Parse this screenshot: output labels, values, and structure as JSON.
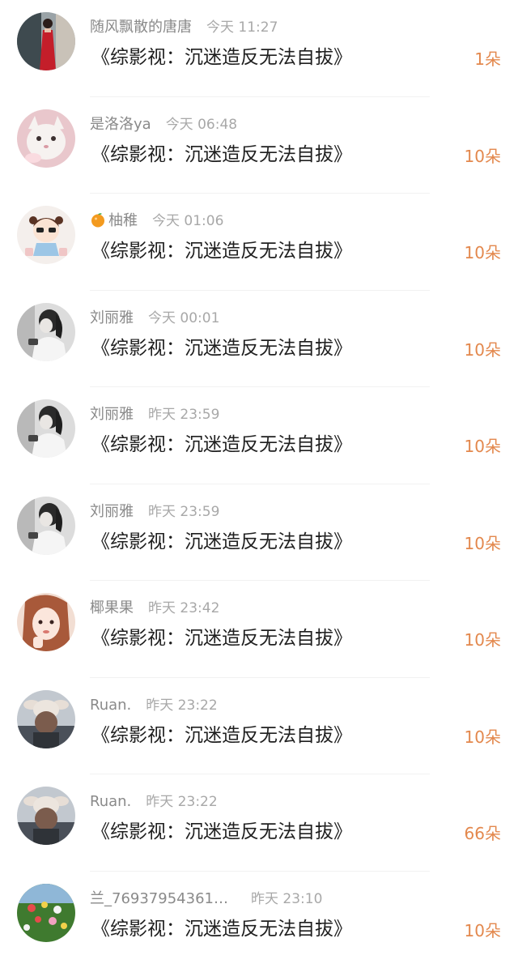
{
  "items": [
    {
      "name": "随风飘散的唐唐",
      "time": "今天 11:27",
      "title": "《综影视：沉迷造反无法自拔》",
      "count": "1朵",
      "avatar": "avatar-red-dress",
      "gap": 18
    },
    {
      "name": "是洛洛ya",
      "time": "今天 06:48",
      "title": "《综影视：沉迷造反无法自拔》",
      "count": "10朵",
      "avatar": "avatar-white-cat",
      "gap": 18
    },
    {
      "name": "柚稚",
      "time": "今天 01:06",
      "title": "《综影视：沉迷造反无法自拔》",
      "count": "10朵",
      "avatar": "avatar-cartoon-girl",
      "emoji": "orange-emoji",
      "gap": 18
    },
    {
      "name": "刘丽雅",
      "time": "今天 00:01",
      "title": "《综影视：沉迷造反无法自拔》",
      "count": "10朵",
      "avatar": "avatar-bw-girl",
      "gap": 18
    },
    {
      "name": "刘丽雅",
      "time": "昨天 23:59",
      "title": "《综影视：沉迷造反无法自拔》",
      "count": "10朵",
      "avatar": "avatar-bw-girl",
      "gap": 18
    },
    {
      "name": "刘丽雅",
      "time": "昨天 23:59",
      "title": "《综影视：沉迷造反无法自拔》",
      "count": "10朵",
      "avatar": "avatar-bw-girl",
      "gap": 18
    },
    {
      "name": "椰果果",
      "time": "昨天 23:42",
      "title": "《综影视：沉迷造反无法自拔》",
      "count": "10朵",
      "avatar": "avatar-girl-portrait",
      "gap": 18
    },
    {
      "name": "Ruan.",
      "time": "昨天 23:22",
      "title": "《综影视：沉迷造反无法自拔》",
      "count": "10朵",
      "avatar": "avatar-bunny-hat",
      "gap": 18
    },
    {
      "name": "Ruan.",
      "time": "昨天 23:22",
      "title": "《综影视：沉迷造反无法自拔》",
      "count": "66朵",
      "avatar": "avatar-bunny-hat",
      "gap": 18
    },
    {
      "name": "兰_76937954361…",
      "time": "昨天 23:10",
      "title": "《综影视：沉迷造反无法自拔》",
      "count": "10朵",
      "avatar": "avatar-flowers",
      "gap": 28
    }
  ],
  "colors": {
    "count": "#e3884d",
    "title": "#1f1f1f",
    "meta": "#8e8e8e",
    "divider": "#f1f1f1"
  }
}
